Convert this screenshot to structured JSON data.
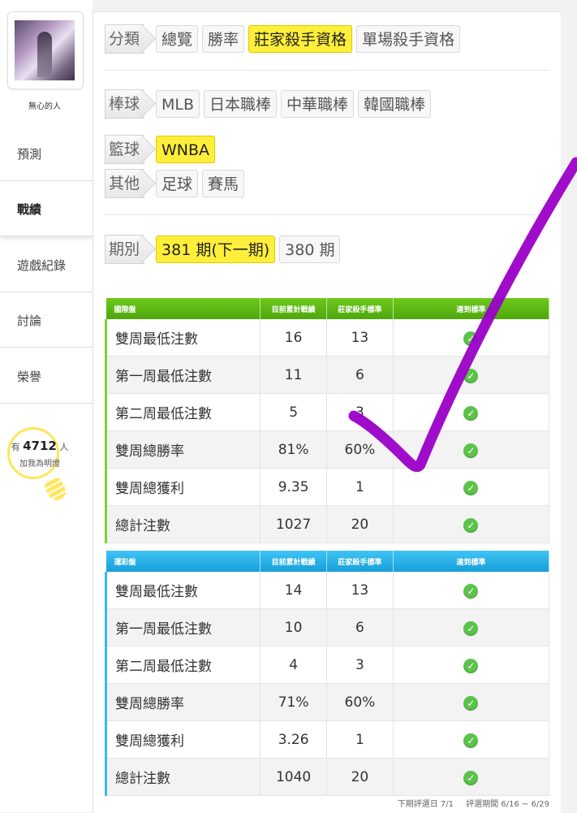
{
  "user": {
    "name": "無心的人"
  },
  "sidebar": {
    "items": [
      {
        "label": "預測"
      },
      {
        "label": "戰績"
      },
      {
        "label": "遊戲紀錄"
      },
      {
        "label": "討論"
      },
      {
        "label": "榮譽"
      }
    ],
    "bulb": {
      "prefix": "有",
      "count": "4712",
      "suffix": "人",
      "caption": "加我為明燈"
    }
  },
  "filters": {
    "category": {
      "label": "分類",
      "items": [
        "總覽",
        "勝率",
        "莊家殺手資格",
        "單場殺手資格"
      ],
      "selected": "莊家殺手資格"
    },
    "baseball": {
      "label": "棒球",
      "items": [
        "MLB",
        "日本職棒",
        "中華職棒",
        "韓國職棒"
      ]
    },
    "basketball": {
      "label": "籃球",
      "items": [
        "WNBA"
      ],
      "selected": "WNBA"
    },
    "other": {
      "label": "其他",
      "items": [
        "足球",
        "賽馬"
      ]
    },
    "period": {
      "label": "期別",
      "items": [
        "381 期(下一期)",
        "380 期"
      ],
      "selected": "381 期(下一期)"
    }
  },
  "tables": [
    {
      "name": "國際盤",
      "headers": [
        "國際盤",
        "目前累計戰績",
        "莊家殺手標準",
        "達到標準"
      ],
      "rows": [
        [
          "雙周最低注數",
          "16",
          "13"
        ],
        [
          "第一周最低注數",
          "11",
          "6"
        ],
        [
          "第二周最低注數",
          "5",
          "3"
        ],
        [
          "雙周總勝率",
          "81%",
          "60%"
        ],
        [
          "雙周總獲利",
          "9.35",
          "1"
        ],
        [
          "總計注數",
          "1027",
          "20"
        ]
      ]
    },
    {
      "name": "運彩盤",
      "headers": [
        "運彩盤",
        "目前累計戰績",
        "莊家殺手標準",
        "達到標準"
      ],
      "rows": [
        [
          "雙周最低注數",
          "14",
          "13"
        ],
        [
          "第一周最低注數",
          "10",
          "6"
        ],
        [
          "第二周最低注數",
          "4",
          "3"
        ],
        [
          "雙周總勝率",
          "71%",
          "60%"
        ],
        [
          "雙周總獲利",
          "3.26",
          "1"
        ],
        [
          "總計注數",
          "1040",
          "20"
        ]
      ]
    }
  ],
  "footer": {
    "next_eval": "下期評選日 7/1",
    "eval_period": "評選期間 6/16 ~ 6/29"
  },
  "colors": {
    "highlight": "#ffef3a",
    "green_header": "#5bb814",
    "blue_header": "#23aee5",
    "check_ok": "#5cc24a",
    "annotation": "#9a00c8"
  }
}
